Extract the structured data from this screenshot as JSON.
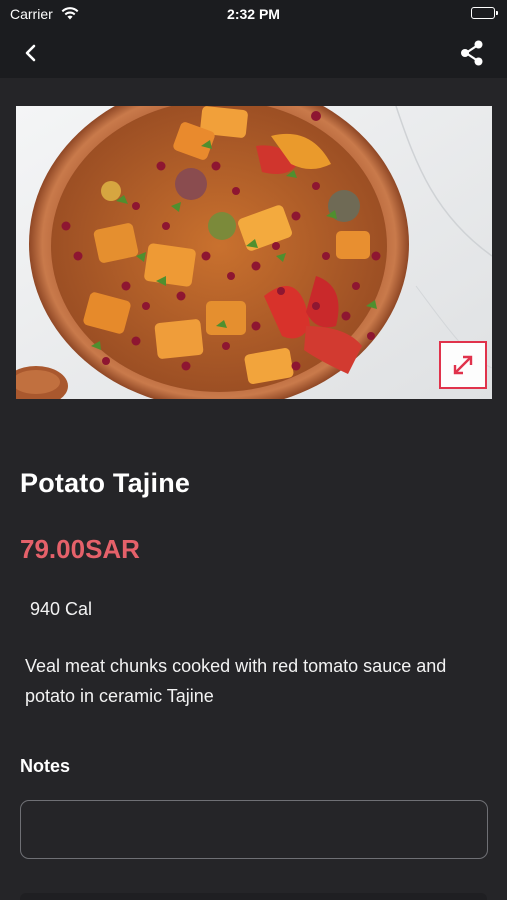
{
  "status_bar": {
    "carrier": "Carrier",
    "time": "2:32 PM"
  },
  "nav": {
    "back_icon": "chevron-left-icon",
    "share_icon": "share-icon"
  },
  "product": {
    "name": "Potato Tajine",
    "price": "79.00SAR",
    "calories": "940 Cal",
    "description": "Veal meat chunks cooked with red tomato sauce and potato in ceramic Tajine"
  },
  "notes": {
    "label": "Notes",
    "value": "",
    "placeholder": ""
  },
  "colors": {
    "background": "#252528",
    "bar": "#1b1c1f",
    "price": "#e5616a",
    "accent": "#e0324b"
  }
}
